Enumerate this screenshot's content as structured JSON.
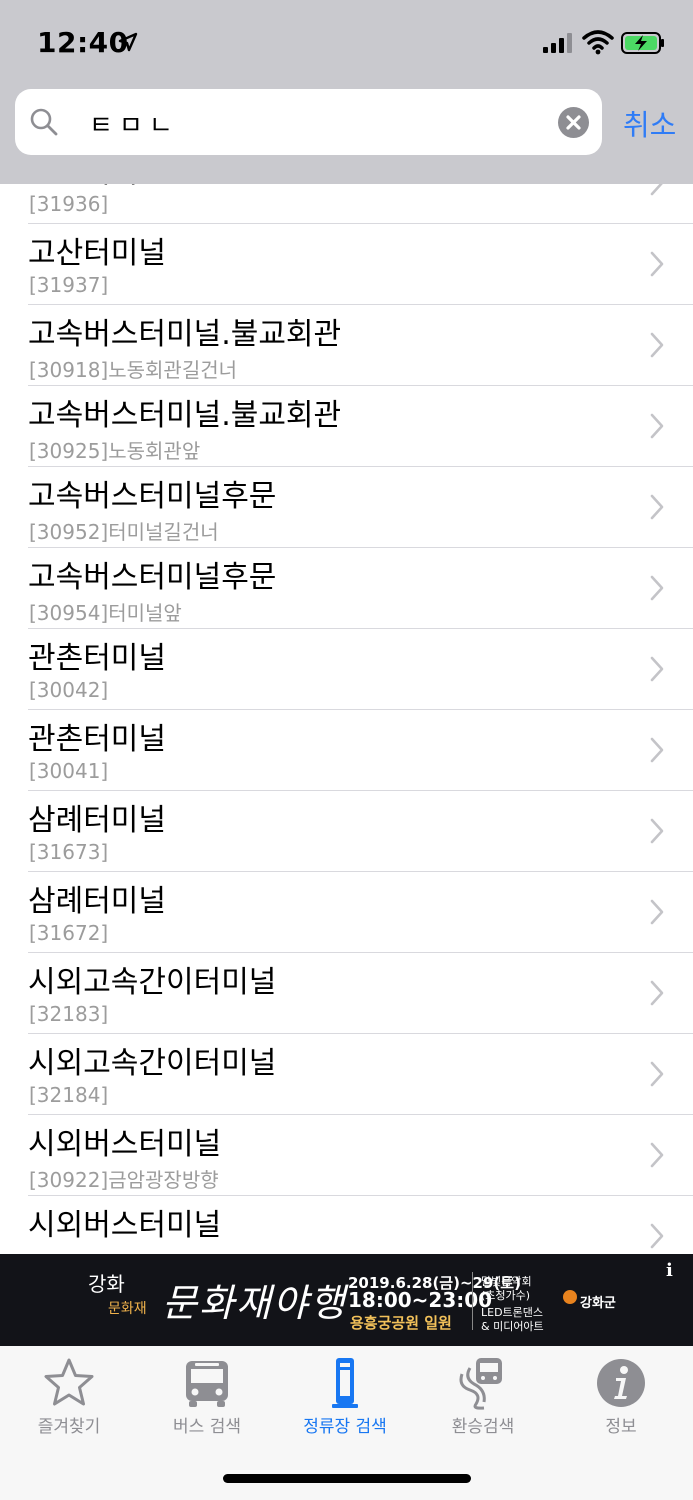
{
  "status_bar": {
    "time": "12:40"
  },
  "search": {
    "query": "ㅌㅁㄴ",
    "cancel_label": "취소"
  },
  "results": [
    {
      "name": "고산터미널",
      "detail": "[31936]"
    },
    {
      "name": "고산터미널",
      "detail": "[31937]"
    },
    {
      "name": "고속버스터미널.불교회관",
      "detail": "[30918]노동회관길건너"
    },
    {
      "name": "고속버스터미널.불교회관",
      "detail": "[30925]노동회관앞"
    },
    {
      "name": "고속버스터미널후문",
      "detail": "[30952]터미널길건너"
    },
    {
      "name": "고속버스터미널후문",
      "detail": "[30954]터미널앞"
    },
    {
      "name": "관촌터미널",
      "detail": "[30042]"
    },
    {
      "name": "관촌터미널",
      "detail": "[30041]"
    },
    {
      "name": "삼례터미널",
      "detail": "[31673]"
    },
    {
      "name": "삼례터미널",
      "detail": "[31672]"
    },
    {
      "name": "시외고속간이터미널",
      "detail": "[32183]"
    },
    {
      "name": "시외고속간이터미널",
      "detail": "[32184]"
    },
    {
      "name": "시외버스터미널",
      "detail": "[30922]금암광장방향"
    },
    {
      "name": "시외버스터미널",
      "detail": ""
    }
  ],
  "ad": {
    "info_mark": "i",
    "logo_top": "강화",
    "logo_bottom": "문화재",
    "festival_title": "문화재야행",
    "date": "2019.6.28(금)~29(토)",
    "hours": "18:00~23:00",
    "place": "용흥궁공원 일원",
    "program_1": "달빛음악회",
    "program_2": "(초청가수)",
    "program_3": "LED트론댄스",
    "program_4": "& 미디어아트",
    "county": "강화군"
  },
  "tabs": [
    {
      "label": "즐겨찾기",
      "icon": "star-icon"
    },
    {
      "label": "버스 검색",
      "icon": "bus-icon"
    },
    {
      "label": "정류장 검색",
      "icon": "bus-stop-icon"
    },
    {
      "label": "환승검색",
      "icon": "transfer-icon"
    },
    {
      "label": "정보",
      "icon": "info-icon"
    }
  ],
  "colors": {
    "accent": "#1877f2",
    "header_bg": "#c9c9ce",
    "ad_bg": "#121318"
  }
}
